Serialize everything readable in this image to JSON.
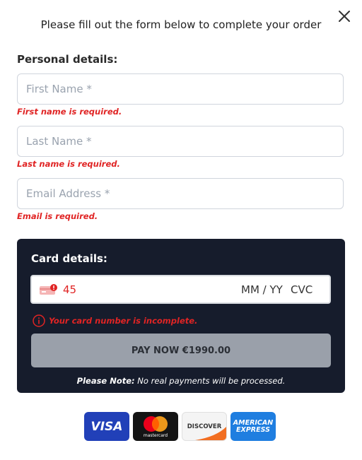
{
  "header": {
    "title": "Please fill out the form below to complete your order"
  },
  "personal": {
    "title": "Personal details:",
    "first_name": {
      "placeholder": "First Name *",
      "value": "",
      "error": "First name is required."
    },
    "last_name": {
      "placeholder": "Last Name *",
      "value": "",
      "error": "Last name is required."
    },
    "email": {
      "placeholder": "Email Address *",
      "value": "",
      "error": "Email is required."
    }
  },
  "card": {
    "title": "Card details:",
    "number": "45",
    "expiry_placeholder": "MM / YY",
    "cvc_placeholder": "CVC",
    "error": "Your card number is incomplete.",
    "pay_label": "PAY NOW €1990.00",
    "note_label": "Please Note:",
    "note_text": " No real payments will be processed."
  },
  "payment_logos": {
    "visa": "VISA",
    "mastercard": "mastercard",
    "discover": "DISCOVER",
    "amex_line1": "AMERICAN",
    "amex_line2": "EXPRESS"
  },
  "colors": {
    "error": "#e02424",
    "panel": "#161c2c",
    "button_disabled": "#9aa0aa"
  }
}
